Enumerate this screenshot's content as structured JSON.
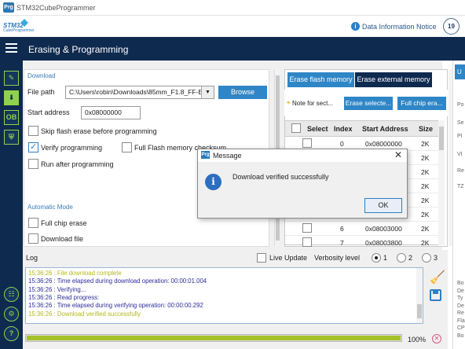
{
  "window": {
    "title": "STM32CubeProgrammer"
  },
  "header": {
    "logo_text": "STM32",
    "logo_sub": "CubeProgrammer",
    "info_link": "Data Information Notice",
    "anniversary": "19"
  },
  "nav": {
    "title": "Erasing & Programming"
  },
  "sidebar": {
    "items": [
      {
        "icon": "pencil-icon",
        "label": ""
      },
      {
        "icon": "download-icon",
        "label": ""
      },
      {
        "icon": "ob-icon",
        "label": "OB"
      },
      {
        "icon": "shield-icon",
        "label": ""
      },
      {
        "icon": "ecosystem-icon",
        "label": ""
      },
      {
        "icon": "settings-icon",
        "label": ""
      },
      {
        "icon": "help-icon",
        "label": "?"
      }
    ]
  },
  "download": {
    "section": "Download",
    "file_path_label": "File path",
    "file_path_value": "C:\\Users\\robin\\Downloads\\85mm_F1.8_FF-E",
    "browse": "Browse",
    "start_address_label": "Start address",
    "start_address_value": "0x08000000",
    "options": [
      {
        "label": "Skip flash erase before programming",
        "checked": false
      },
      {
        "label": "Verify programming",
        "checked": true
      },
      {
        "label": "Full Flash memory checksum",
        "checked": false
      },
      {
        "label": "Run after programming",
        "checked": false
      }
    ]
  },
  "automatic": {
    "section": "Automatic Mode",
    "options": [
      {
        "label": "Full chip erase",
        "checked": false
      },
      {
        "label": "Download file",
        "checked": false
      }
    ]
  },
  "erase": {
    "tabs": [
      "Erase flash memory",
      "Erase external memory"
    ],
    "note": "Note for sect...",
    "erase_selected": "Erase selecte...",
    "full_chip_erase": "Full chip era...",
    "columns": [
      "Select",
      "Index",
      "Start Address",
      "Size"
    ],
    "rows": [
      {
        "index": "0",
        "address": "0x08000000",
        "size": "2K"
      },
      {
        "index": "",
        "address": "",
        "size": "2K"
      },
      {
        "index": "",
        "address": "",
        "size": "2K"
      },
      {
        "index": "",
        "address": "",
        "size": "2K"
      },
      {
        "index": "",
        "address": "",
        "size": "2K"
      },
      {
        "index": "",
        "address": "",
        "size": "2K"
      },
      {
        "index": "6",
        "address": "0x08003000",
        "size": "2K"
      },
      {
        "index": "7",
        "address": "0x08003800",
        "size": "2K"
      }
    ]
  },
  "right_panel": {
    "button": "U",
    "labels": [
      "Po",
      "Se",
      "PI",
      "VI",
      "Re",
      "TZ"
    ],
    "lower_labels": [
      "Bo",
      "De",
      "Ty",
      "De",
      "Re",
      "Fla",
      "CP",
      "Bo"
    ]
  },
  "log": {
    "label": "Log",
    "live_update": "Live Update",
    "verbosity": "Verbosity level",
    "verbosity_options": [
      "1",
      "2",
      "3"
    ],
    "verbosity_selected": "1",
    "lines": [
      {
        "text": "15:36:26 : File download complete",
        "color": "#b5b81e"
      },
      {
        "text": "15:36:26 : Time elapsed during download operation: 00:00:01.004",
        "color": "#2d2d9a"
      },
      {
        "text": "15:36:26 : Verifying...",
        "color": "#2d2d9a"
      },
      {
        "text": "15:36:26 : Read progress:",
        "color": "#2d2d9a"
      },
      {
        "text": "15:36:26 : Time elapsed during verifying operation: 00:00:00.292",
        "color": "#2d2d9a"
      },
      {
        "text": "15:36:26 : Download verified successfully",
        "color": "#b5b81e"
      }
    ],
    "progress": 1.0,
    "progress_label": "100%"
  },
  "dialog": {
    "title": "Message",
    "message": "Download verified successfully",
    "ok": "OK",
    "close": "✕"
  },
  "colors": {
    "navbar": "#0f2a4f",
    "accent": "#2f86c6",
    "progress": "#a5c22a"
  }
}
